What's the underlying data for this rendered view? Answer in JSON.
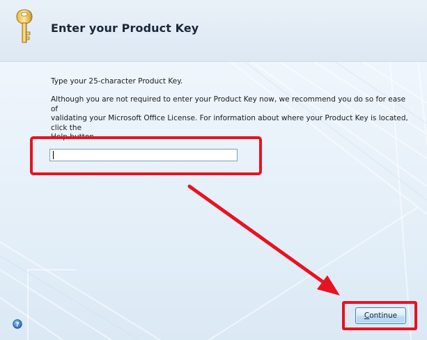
{
  "header": {
    "title": "Enter your Product Key",
    "icon": "key-icon"
  },
  "body": {
    "instruction": "Type your 25-character Product Key.",
    "description_line1": "Although you are not required to enter your Product Key now, we recommend you do so for ease of",
    "description_line2": "validating your Microsoft Office License. For information about where your Product Key is located, click the",
    "description_line3": "Help button."
  },
  "product_key_input": {
    "value": "",
    "placeholder": ""
  },
  "footer": {
    "continue_label_first": "C",
    "continue_label_rest": "ontinue",
    "help_icon": "help-icon"
  },
  "annotations": {
    "highlight_color": "#e8121f"
  },
  "colors": {
    "accent": "#3c7fb1",
    "background": "#eef5fb",
    "title_text": "#1a2638"
  }
}
